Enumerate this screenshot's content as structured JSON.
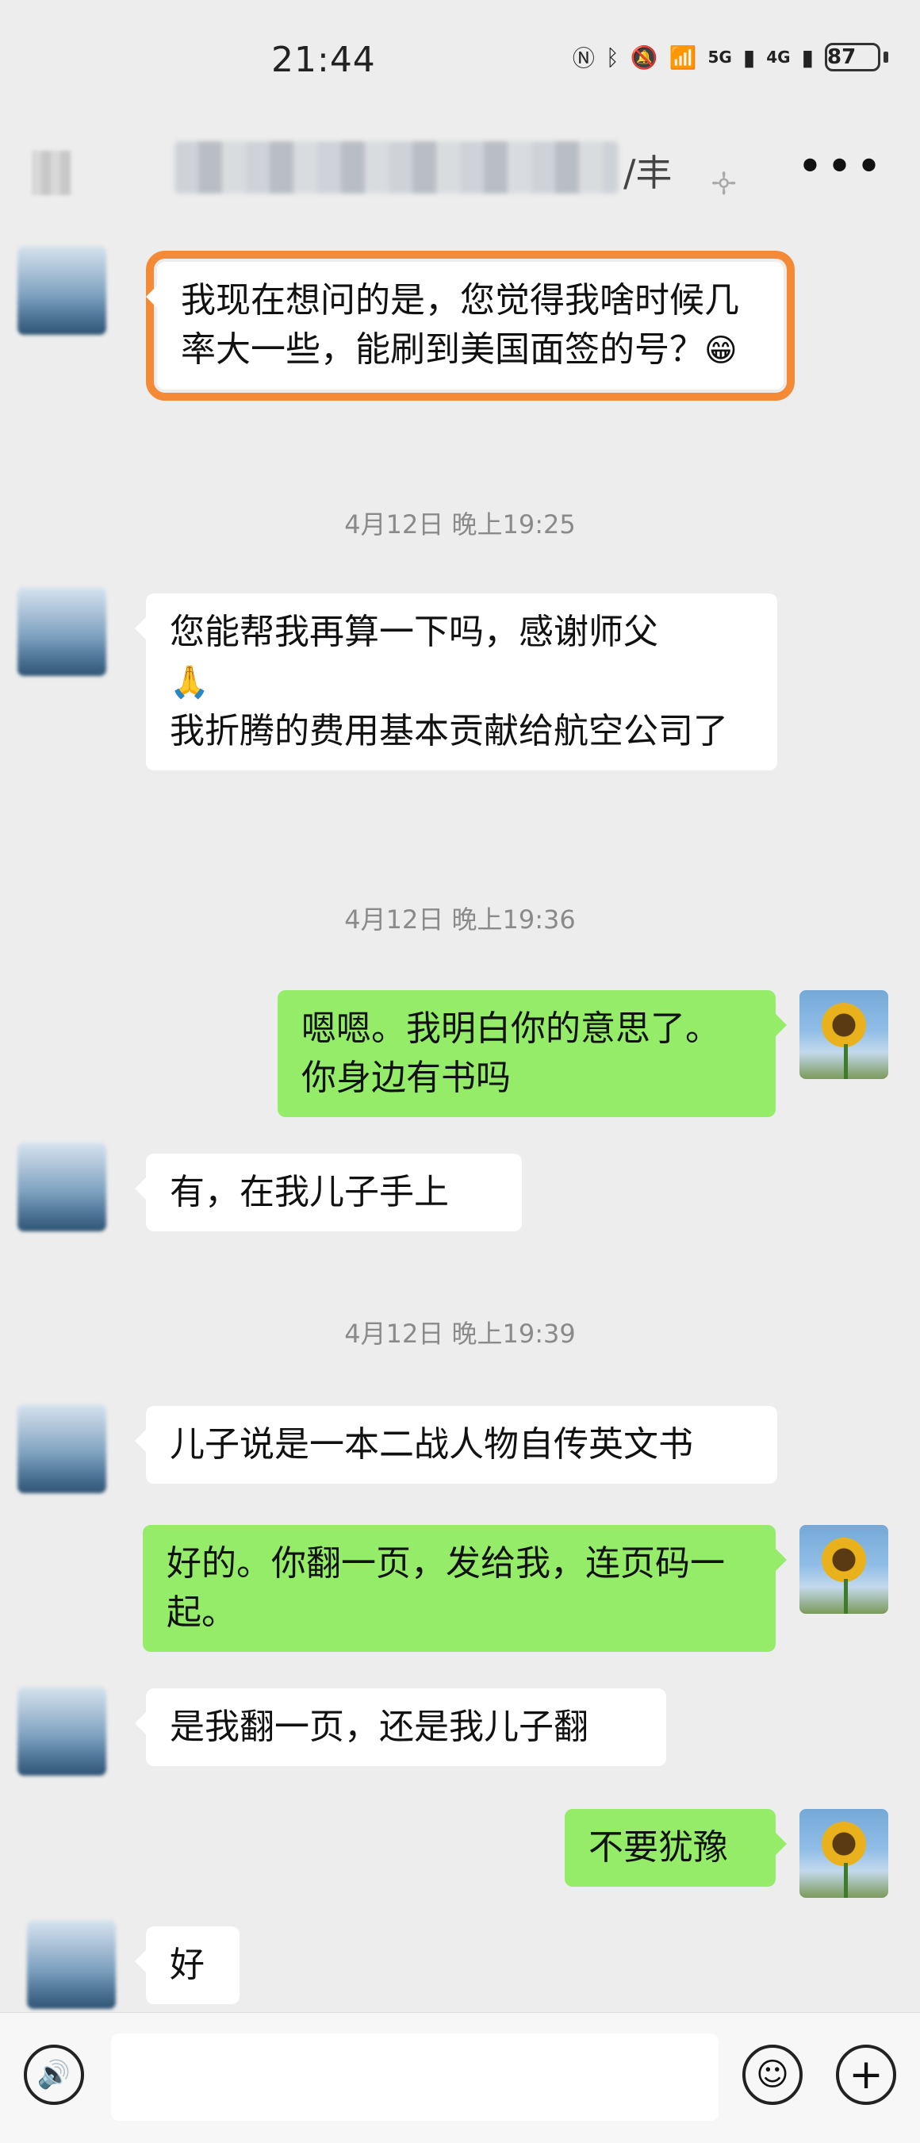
{
  "status_bar": {
    "time": "21:44",
    "icons": [
      "nfc-icon",
      "bluetooth-icon",
      "mute-icon",
      "wifi-icon",
      "5g-signal-icon",
      "4g-signal-icon"
    ],
    "signal_5g": "5G",
    "signal_4g": "4G",
    "battery": "87"
  },
  "header": {
    "title_visible_tail": "/丰",
    "more_label": "•••"
  },
  "chat": {
    "m1": "我现在想问的是，您觉得我啥时候几率大一些，能刷到美国面签的号？",
    "m1_emoji": "😁",
    "t1": "4月12日 晚上19:25",
    "m2_line1": "您能帮我再算一下吗，感谢师父",
    "m2_emoji": "🙏",
    "m2_line2": "我折腾的费用基本贡献给航空公司了",
    "t2": "4月12日 晚上19:36",
    "m3": "嗯嗯。我明白你的意思了。你身边有书吗",
    "m4": "有，在我儿子手上",
    "t3": "4月12日 晚上19:39",
    "m5": "儿子说是一本二战人物自传英文书",
    "m6": "好的。你翻一页，发给我，连页码一起。",
    "m7": "是我翻一页，还是我儿子翻",
    "m8": "不要犹豫",
    "m9": "好"
  },
  "input_bar": {
    "voice_icon": "🔊",
    "emoji_icon": "☺",
    "plus_icon": "+"
  },
  "colors": {
    "background": "#ededed",
    "bubble_me": "#95ec69",
    "bubble_other": "#ffffff",
    "highlight": "#f58a36"
  }
}
